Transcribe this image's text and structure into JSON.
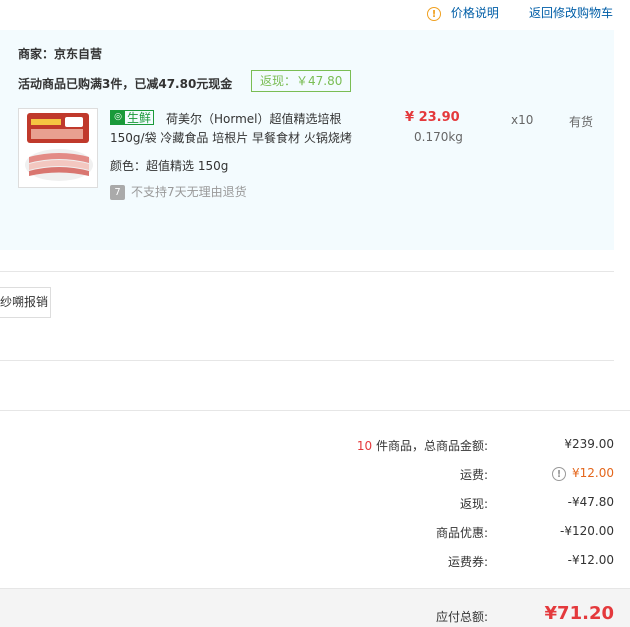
{
  "header": {
    "price_info_label": "价格说明",
    "back_to_cart_label": "返回修改购物车"
  },
  "order": {
    "seller": "商家：京东自营",
    "promo": "活动商品已购满3件，已减47.80元现金",
    "rebate_tag": "返现：￥47.80",
    "product": {
      "badge": "生鲜",
      "name_line1": "荷美尔（Hormel）超值精选培根",
      "name_line2": "150g/袋 冷藏食品 培根片 早餐食材 火锅烧烤",
      "color_label": "颜色：",
      "color_value": "超值精选 150g",
      "no_return_icon": "7",
      "no_return": "不支持7天无理由退货",
      "price": "¥ 23.90",
      "weight": "0.170kg",
      "quantity": "x10",
      "stock": "有货"
    }
  },
  "invoice": {
    "button_label": "纱嗍报销"
  },
  "summary": {
    "count": "10",
    "count_suffix": " 件商品，总商品金额:",
    "total_goods": "¥239.00",
    "shipping_label": "运费:",
    "shipping_value": "¥12.00",
    "rebate_label": "返现:",
    "rebate_value": "-¥47.80",
    "discount_label": "商品优惠:",
    "discount_value": "-¥120.00",
    "coupon_label": "运费券:",
    "coupon_value": "-¥12.00",
    "payable_label": "应付总额:",
    "payable_value": "¥71.20"
  },
  "colors": {
    "accent_red": "#e4393c",
    "link_blue": "#005ea7",
    "fresh_green": "#1a9a3a",
    "rebate_green": "#7abd54",
    "warn_orange": "#f0a020"
  },
  "icons": {
    "price_info": "warning-circle-icon",
    "shipping_info": "info-circle-icon",
    "fresh": "fresh-food-icon",
    "no_return": "no-return-icon"
  }
}
